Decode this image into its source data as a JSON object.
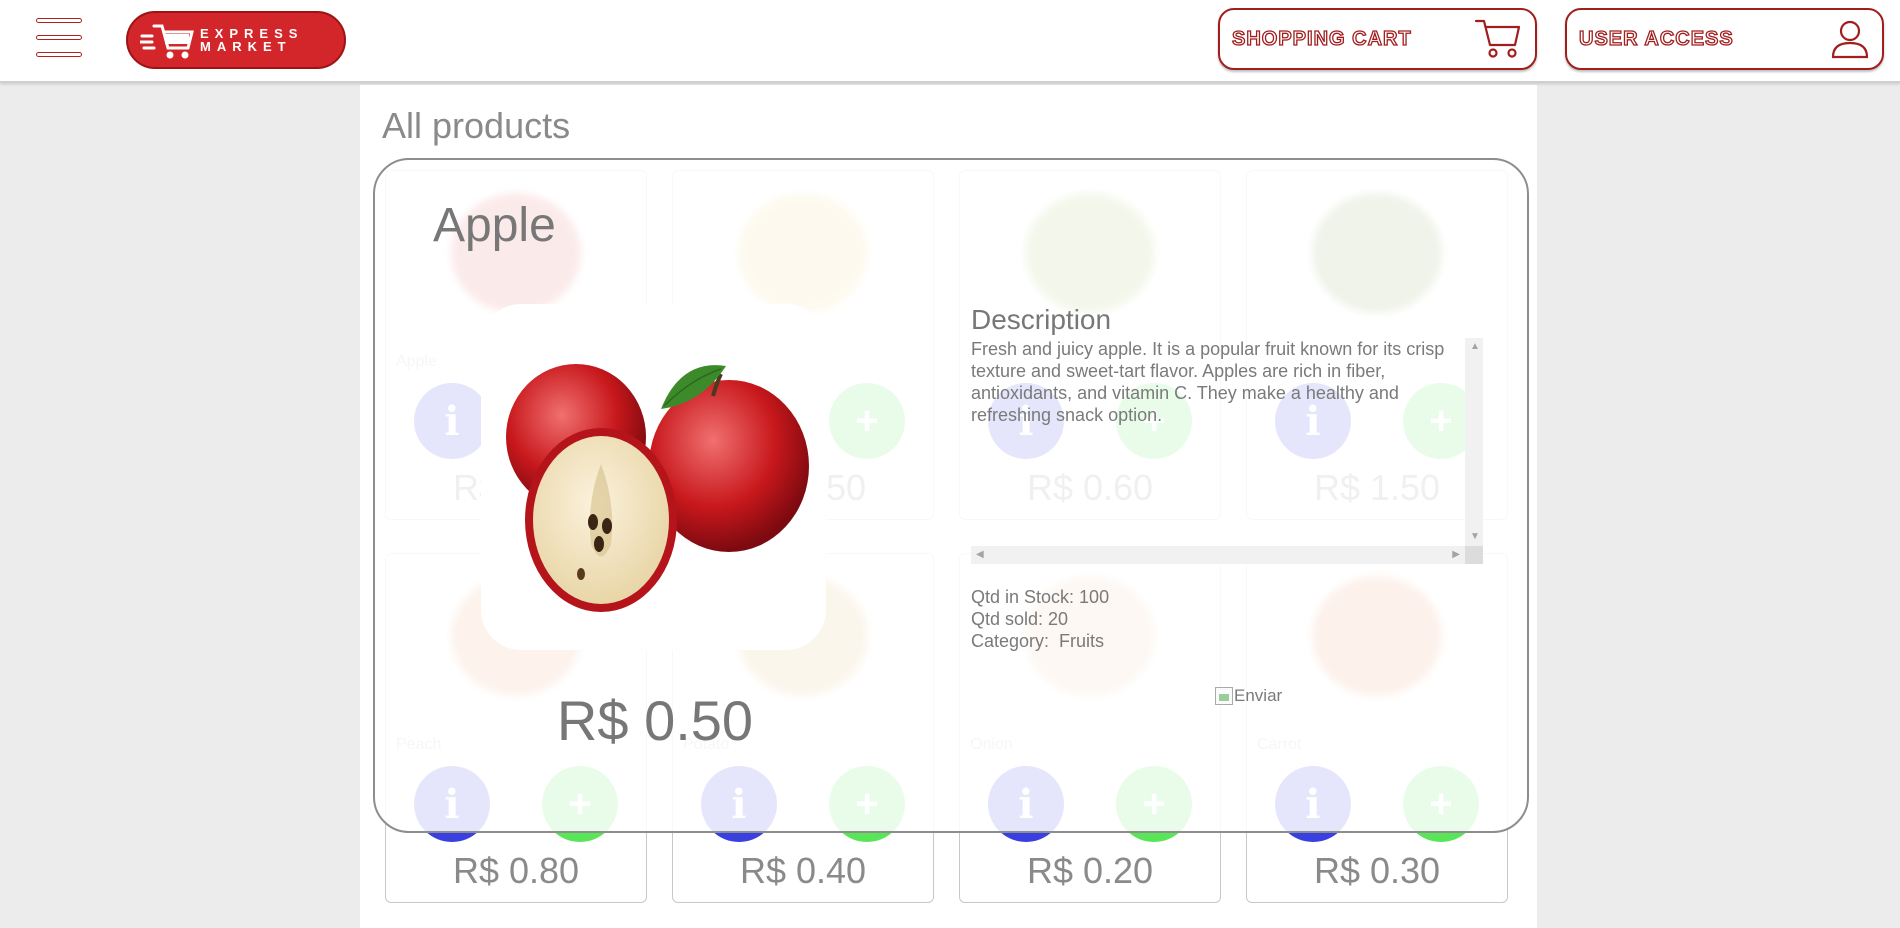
{
  "header": {
    "logo_text_line1": "EXPRESS",
    "logo_text_line2": "MARKET",
    "cart_label": "SHOPPING CART",
    "user_label": "USER ACCESS"
  },
  "main": {
    "title": "All products"
  },
  "products": [
    {
      "name": "Apple",
      "price": "R$ 0.50",
      "color": "#d8383a"
    },
    {
      "name": "",
      "price": "R$ 0.50",
      "color": "#e8c860"
    },
    {
      "name": "",
      "price": "R$ 0.60",
      "color": "#8db43c"
    },
    {
      "name": "",
      "price": "R$ 1.50",
      "color": "#6a8a2c"
    },
    {
      "name": "Peach",
      "price": "R$ 0.80",
      "color": "#e8864c"
    },
    {
      "name": "Potato",
      "price": "R$ 0.40",
      "color": "#d8a84c"
    },
    {
      "name": "Onion",
      "price": "R$ 0.20",
      "color": "#e8b890"
    },
    {
      "name": "Carrot",
      "price": "R$ 0.30",
      "color": "#e8783c"
    }
  ],
  "modal": {
    "title": "Apple",
    "price": "R$ 0.50",
    "description_title": "Description",
    "description": "Fresh and juicy apple. It is a popular fruit known for its crisp texture and sweet-tart flavor. Apples are rich in fiber, antioxidants, and vitamin C. They make a healthy and refreshing snack option.",
    "stock": "Qtd in Stock: 100",
    "sold": "Qtd sold: 20",
    "category": "Category:  Fruits",
    "send_alt": "Enviar"
  },
  "colors": {
    "brand_red": "#d3262a",
    "info_blue": "#3a3fe0",
    "add_green": "#58e658"
  }
}
